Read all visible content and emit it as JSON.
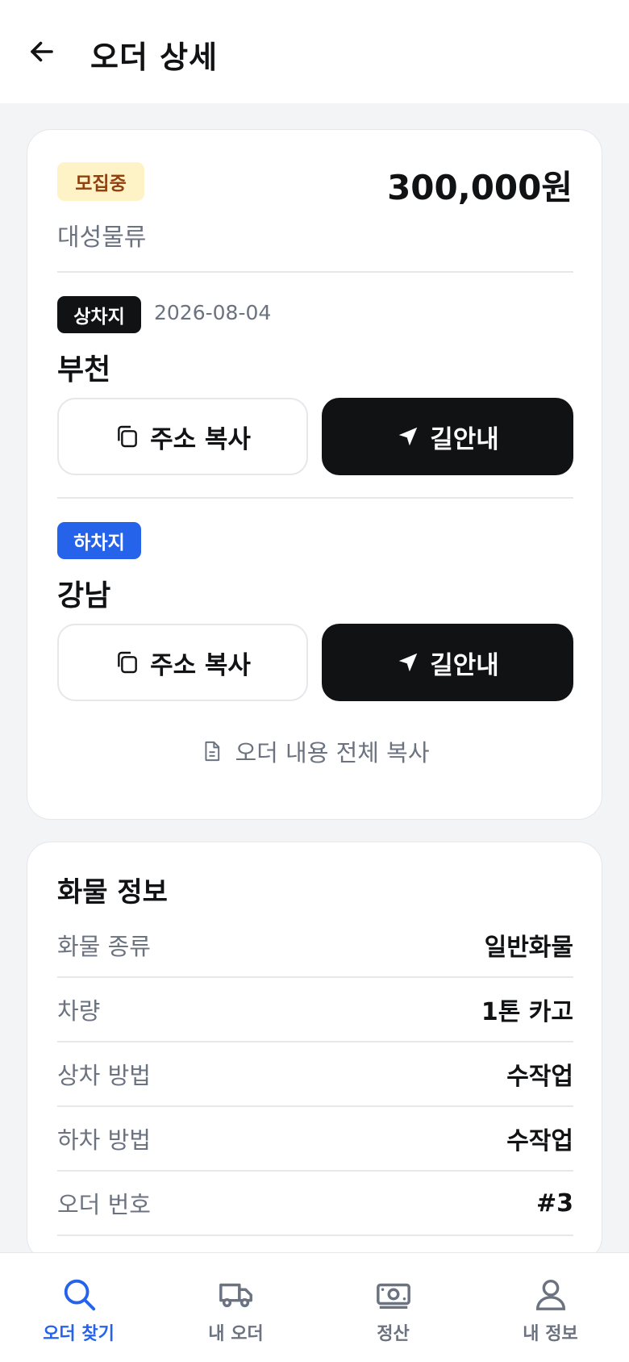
{
  "header": {
    "title": "오더 상세",
    "back_icon": "arrow-left-icon"
  },
  "order": {
    "status": "모집중",
    "price": "300,000원",
    "company": "대성물류",
    "pickup": {
      "badge": "상차지",
      "date": "2026-08-04",
      "place": "부천",
      "copy_label": "주소 복사",
      "nav_label": "길안내"
    },
    "dropoff": {
      "badge": "하차지",
      "place": "강남",
      "copy_label": "주소 복사",
      "nav_label": "길안내"
    },
    "copy_all_label": "오더 내용 전체 복사"
  },
  "cargo": {
    "title": "화물 정보",
    "rows": [
      {
        "label": "화물 종류",
        "value": "일반화물"
      },
      {
        "label": "차량",
        "value": "1톤 카고"
      },
      {
        "label": "상차 방법",
        "value": "수작업"
      },
      {
        "label": "하차 방법",
        "value": "수작업"
      },
      {
        "label": "오더 번호",
        "value": "#3"
      }
    ]
  },
  "tabs": [
    {
      "label": "오더 찾기",
      "icon": "search-icon",
      "active": true
    },
    {
      "label": "내 오더",
      "icon": "truck-icon",
      "active": false
    },
    {
      "label": "정산",
      "icon": "money-icon",
      "active": false
    },
    {
      "label": "내 정보",
      "icon": "user-icon",
      "active": false
    }
  ],
  "colors": {
    "accent": "#2563eb",
    "dark": "#111214",
    "status_bg": "#fef3c7",
    "status_text": "#92400e",
    "muted": "#6b7280"
  }
}
